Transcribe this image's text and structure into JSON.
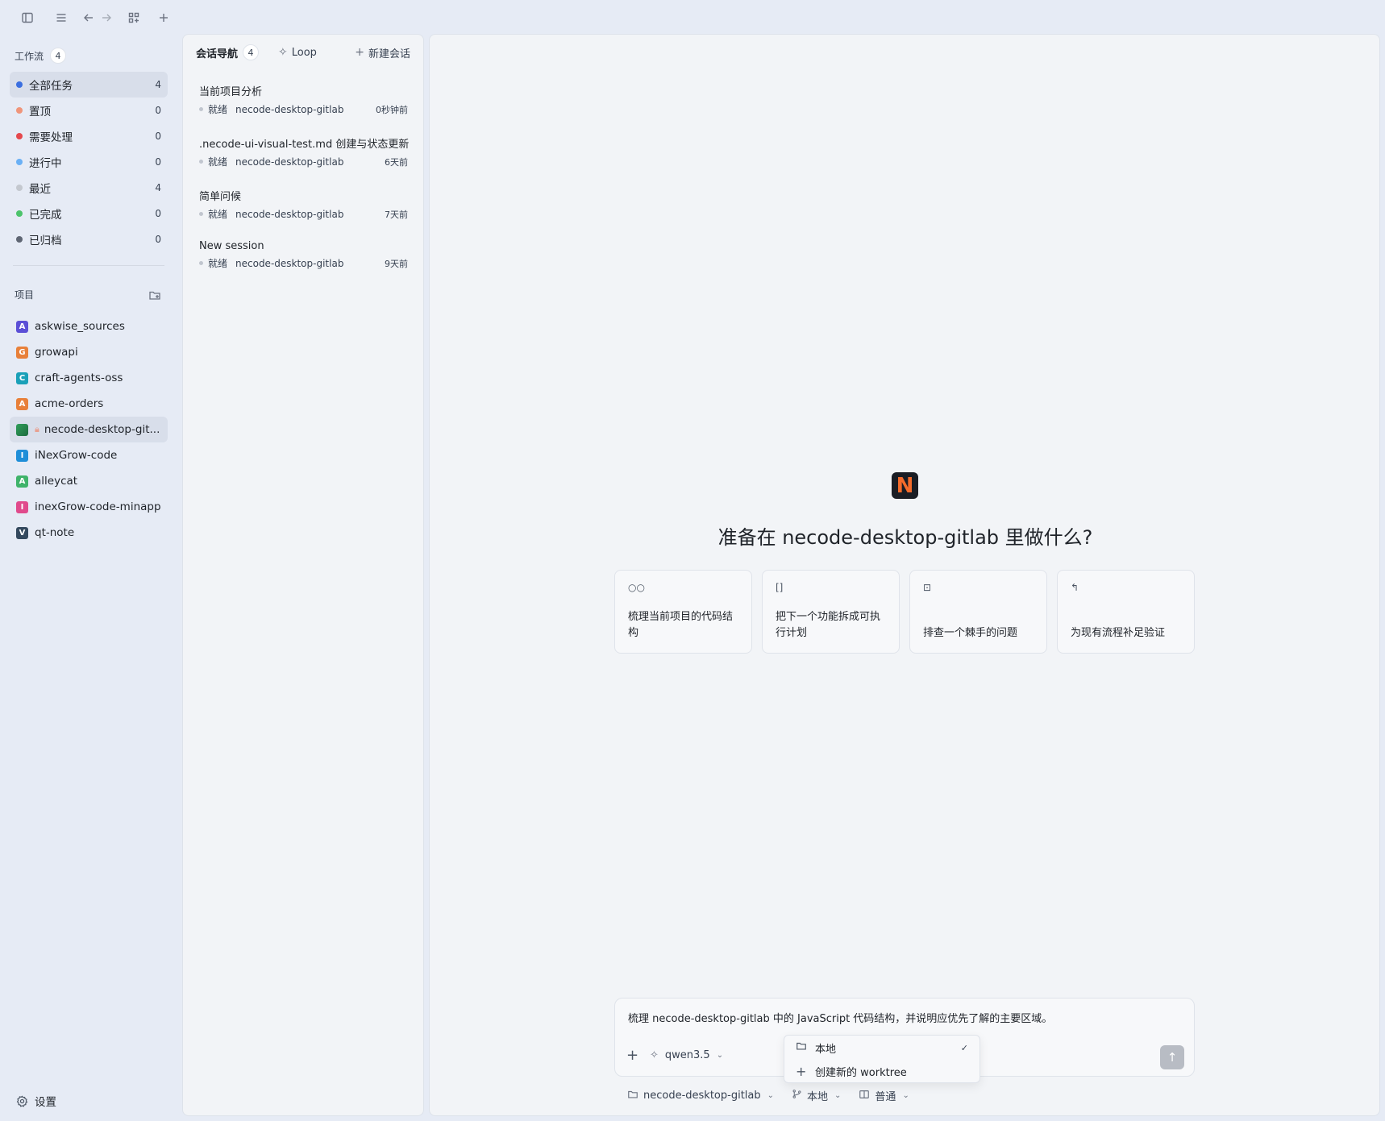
{
  "toolbar": {
    "icons": [
      "sidebar-toggle-icon",
      "menu-icon",
      "back-arrow-icon",
      "forward-arrow-icon",
      "apps-grid-icon",
      "plus-icon"
    ]
  },
  "workflow": {
    "title": "工作流",
    "count": "4",
    "items": [
      {
        "label": "全部任务",
        "count": "4",
        "color": "#3b6fe0"
      },
      {
        "label": "置顶",
        "count": "0",
        "color": "#f0957a"
      },
      {
        "label": "需要处理",
        "count": "0",
        "color": "#e5484d"
      },
      {
        "label": "进行中",
        "count": "0",
        "color": "#6ab0f5"
      },
      {
        "label": "最近",
        "count": "4",
        "color": "#c4c8cf"
      },
      {
        "label": "已完成",
        "count": "0",
        "color": "#4cc36b"
      },
      {
        "label": "已归档",
        "count": "0",
        "color": "#5f6673"
      }
    ]
  },
  "projects": {
    "title": "项目",
    "items": [
      {
        "label": "askwise_sources",
        "initial": "A",
        "color": "#5b4fd6"
      },
      {
        "label": "growapi",
        "initial": "G",
        "color": "#e8803a"
      },
      {
        "label": "craft-agents-oss",
        "initial": "C",
        "color": "#1aa0b8"
      },
      {
        "label": "acme-orders",
        "initial": "A",
        "color": "#e8803a"
      },
      {
        "label": "necode-desktop-git...",
        "initial": "",
        "color": "#2f9e5a"
      },
      {
        "label": "iNexGrow-code",
        "initial": "I",
        "color": "#1f8ed8"
      },
      {
        "label": "alleycat",
        "initial": "A",
        "color": "#3fb36a"
      },
      {
        "label": "inexGrow-code-minapp",
        "initial": "I",
        "color": "#e04a8c"
      },
      {
        "label": "qt-note",
        "initial": "V",
        "color": "#34495e"
      }
    ]
  },
  "settings_label": "设置",
  "nav": {
    "title": "会话导航",
    "count": "4",
    "loop_label": "Loop",
    "new_label": "新建会话",
    "sessions": [
      {
        "title": "当前项目分析",
        "status": "就绪",
        "project": "necode-desktop-gitlab",
        "time": "0秒钟前"
      },
      {
        "title": ".necode-ui-visual-test.md 创建与状态更新",
        "status": "就绪",
        "project": "necode-desktop-gitlab",
        "time": "6天前"
      },
      {
        "title": "简单问候",
        "status": "就绪",
        "project": "necode-desktop-gitlab",
        "time": "7天前"
      },
      {
        "title": "New session",
        "status": "就绪",
        "project": "necode-desktop-gitlab",
        "time": "9天前"
      }
    ]
  },
  "main": {
    "logo_letter": "N",
    "headline": "准备在 necode-desktop-gitlab 里做什么?",
    "cards": [
      {
        "icon": "glasses-icon",
        "glyph": "○○",
        "text": "梳理当前项目的代码结构"
      },
      {
        "icon": "book-icon",
        "glyph": "[]",
        "text": "把下一个功能拆成可执行计划"
      },
      {
        "icon": "debug-icon",
        "glyph": "⊡",
        "text": "排查一个棘手的问题"
      },
      {
        "icon": "undo-icon",
        "glyph": "↰",
        "text": "为现有流程补足验证"
      }
    ],
    "prompt": "梳理 necode-desktop-gitlab 中的 JavaScript 代码结构，并说明应优先了解的主要区域。",
    "model": "qwen3.5",
    "dropdown": [
      {
        "label": "本地",
        "checked": true
      },
      {
        "label": "创建新的 worktree",
        "checked": false
      }
    ],
    "footer": {
      "project": "necode-desktop-gitlab",
      "branch": "本地",
      "mode": "普通"
    }
  }
}
